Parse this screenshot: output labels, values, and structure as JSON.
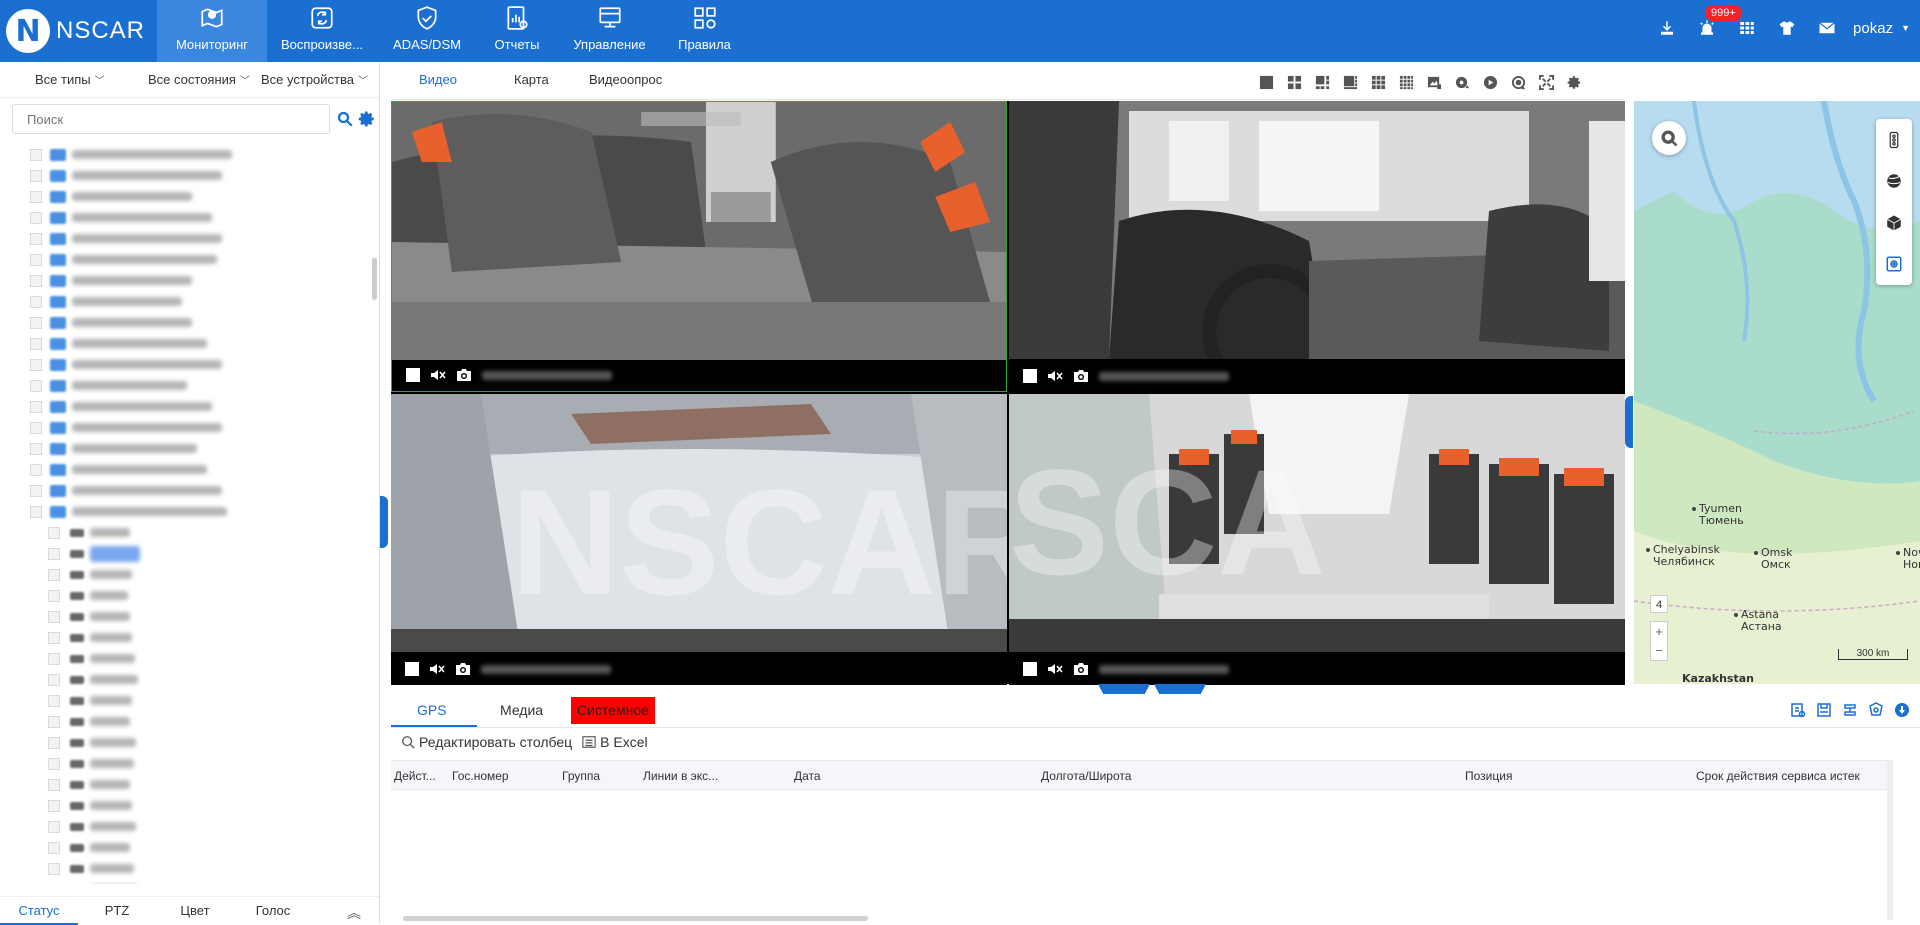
{
  "app": {
    "logo_text": "NSCAR",
    "logo_letter": "N"
  },
  "nav": [
    {
      "label": "Мониторинг",
      "icon": "map-pin-icon",
      "active": true
    },
    {
      "label": "Воспроизве...",
      "icon": "playback-icon",
      "active": false
    },
    {
      "label": "ADAS/DSM",
      "icon": "shield-icon",
      "active": false
    },
    {
      "label": "Отчеты",
      "icon": "report-icon",
      "active": false
    },
    {
      "label": "Управление",
      "icon": "manage-icon",
      "active": false
    },
    {
      "label": "Правила",
      "icon": "rules-icon",
      "active": false
    }
  ],
  "topright": {
    "icons": [
      "download-icon",
      "alarm-icon",
      "grid-icon",
      "shirt-icon",
      "mail-icon"
    ],
    "alarm_badge": "999+",
    "user": "pokaz"
  },
  "filters": {
    "type": "Все типы",
    "state": "Все состояния",
    "device": "Все устройства"
  },
  "search": {
    "placeholder": "Поиск"
  },
  "left_tabs": [
    "Статус",
    "PTZ",
    "Цвет",
    "Голос"
  ],
  "video_tabs": {
    "video": "Видео",
    "map": "Карта",
    "poll": "Видеоопрос"
  },
  "layout_icons": [
    "layout-1-icon",
    "layout-4-icon",
    "layout-6-icon",
    "layout-8-icon",
    "layout-9-icon",
    "layout-16-icon",
    "snapshot-icon",
    "record-icon",
    "play-icon",
    "stop-record-icon",
    "fullscreen-icon",
    "settings-icon"
  ],
  "map": {
    "cities": [
      {
        "en": "Tyumen",
        "ru": "Тюмень"
      },
      {
        "en": "Chelyabinsk",
        "ru": "Челябинск"
      },
      {
        "en": "Omsk",
        "ru": "Омск"
      },
      {
        "en": "Nov",
        "ru": "Нов"
      },
      {
        "en": "Astana",
        "ru": "Астана"
      },
      {
        "en": "Kazakhstan",
        "ru": ""
      }
    ],
    "zoom": "4",
    "scale": "300 km"
  },
  "bottom": {
    "tabs": {
      "gps": "GPS",
      "media": "Медиа",
      "system": "Системное"
    },
    "toolbar": {
      "edit_columns": "Редактировать столбец",
      "excel": "В Excel"
    },
    "columns": [
      "Дейст...",
      "Гос.номер",
      "Группа",
      "Линии в экс...",
      "Дата",
      "Долгота/Широта",
      "Позиция",
      "Срок действия сервиса истек"
    ],
    "accent": "#1a6fd1",
    "system_color": "#ff0000"
  }
}
